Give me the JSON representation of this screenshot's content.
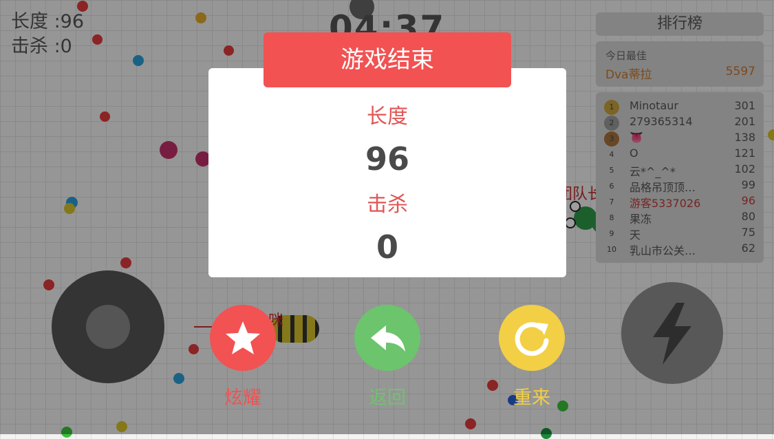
{
  "hud": {
    "length_label": "长度 :96",
    "kills_label": "击杀 :0",
    "timer": "04:37"
  },
  "leaderboard": {
    "title": "排行榜",
    "best_label": "今日最佳",
    "best_name": "Dva蒂拉",
    "best_score": "5597",
    "rows": [
      {
        "rank": "1",
        "name": "Minotaur",
        "score": "301"
      },
      {
        "rank": "2",
        "name": "279365314",
        "score": "201"
      },
      {
        "rank": "3",
        "name": "👅",
        "score": "138"
      },
      {
        "rank": "4",
        "name": "O",
        "score": "121"
      },
      {
        "rank": "5",
        "name": "云*^_^*",
        "score": "102"
      },
      {
        "rank": "6",
        "name": "品格吊顶顶…",
        "score": "99"
      },
      {
        "rank": "7",
        "name": "游客5337026",
        "score": "96"
      },
      {
        "rank": "8",
        "name": "果冻",
        "score": "80"
      },
      {
        "rank": "9",
        "name": "天",
        "score": "75"
      },
      {
        "rank": "10",
        "name": "乳山市公关…",
        "score": "62"
      }
    ]
  },
  "in_game_labels": {
    "snake_label_right": "团队长",
    "snake_label_left": "咪"
  },
  "dialog": {
    "title": "游戏结束",
    "length_label": "长度",
    "length_value": "96",
    "kills_label": "击杀",
    "kills_value": "0"
  },
  "actions": [
    {
      "label": "炫耀",
      "icon": "star-icon",
      "color": "#f25252"
    },
    {
      "label": "返回",
      "icon": "back-arrow-icon",
      "color": "#6cc46c"
    },
    {
      "label": "重来",
      "icon": "restart-icon",
      "color": "#f2cf45"
    }
  ]
}
